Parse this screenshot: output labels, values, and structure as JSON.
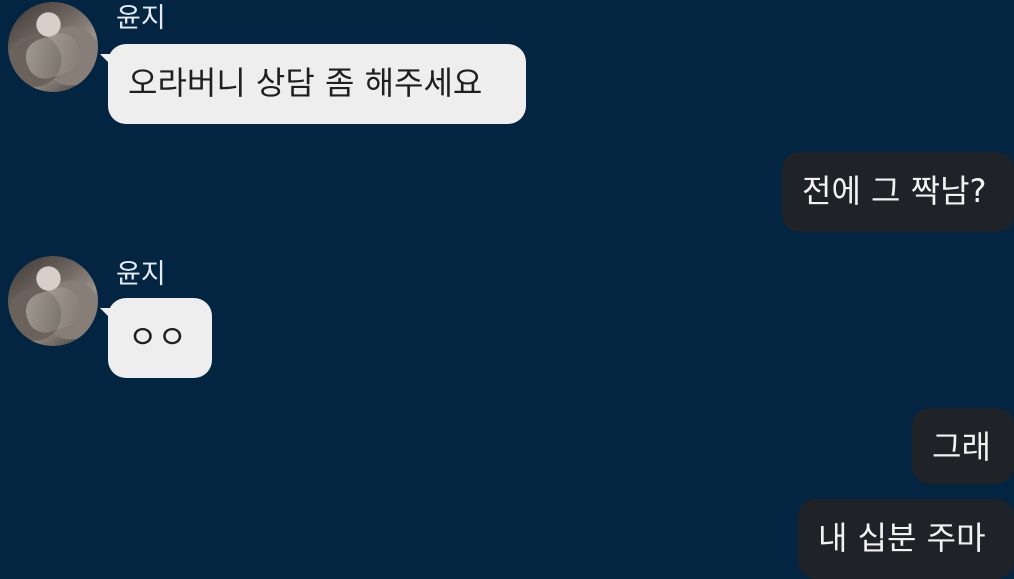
{
  "colors": {
    "background": "#032542",
    "incoming_bubble": "#eeeeee",
    "outgoing_bubble": "#1f2226",
    "sender_name": "#e6ebf2"
  },
  "messages": [
    {
      "direction": "incoming",
      "sender": "윤지",
      "text": "오라버니 상담 좀 해주세요",
      "avatar": "profile-photo"
    },
    {
      "direction": "outgoing",
      "text": "전에 그 짝남?"
    },
    {
      "direction": "incoming",
      "sender": "윤지",
      "text": "ㅇㅇ",
      "avatar": "profile-photo"
    },
    {
      "direction": "outgoing",
      "text": "그래"
    },
    {
      "direction": "outgoing",
      "text": "내 십분 주마"
    }
  ]
}
